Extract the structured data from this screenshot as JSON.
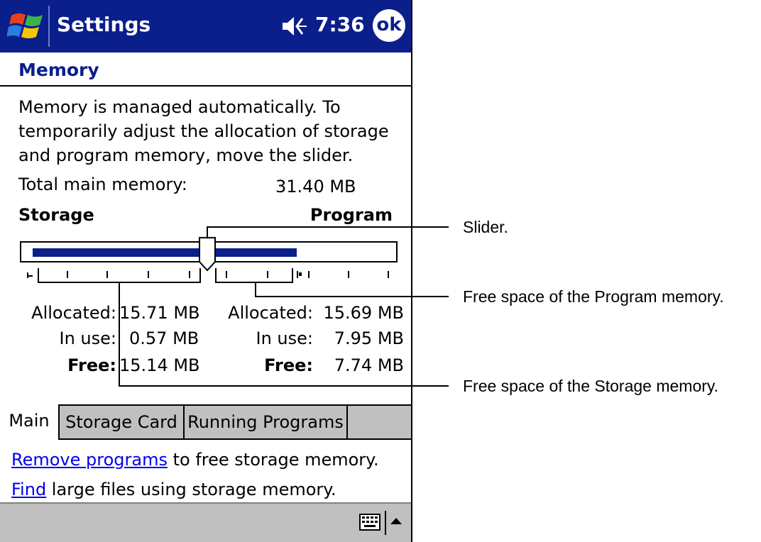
{
  "titlebar": {
    "title": "Settings",
    "time": "7:36",
    "ok_label": "ok"
  },
  "page": {
    "heading": "Memory",
    "description": "Memory is managed automatically. To temporarily adjust the allocation of storage and program memory, move the slider.",
    "total_label": "Total main memory:",
    "total_value": "31.40 MB",
    "storage_label": "Storage",
    "program_label": "Program"
  },
  "slider": {
    "storage_fraction": 0.5,
    "program_in_use_fraction": 0.75
  },
  "storage": {
    "allocated_label": "Allocated:",
    "allocated_value": "15.71 MB",
    "in_use_label": "In use:",
    "in_use_value": "0.57 MB",
    "free_label": "Free:",
    "free_value": "15.14 MB"
  },
  "program": {
    "allocated_label": "Allocated:",
    "allocated_value": "15.69 MB",
    "in_use_label": "In use:",
    "in_use_value": "7.95 MB",
    "free_label": "Free:",
    "free_value": "7.74 MB"
  },
  "tabs": [
    {
      "label": "Main",
      "active": true
    },
    {
      "label": "Storage Card",
      "active": false
    },
    {
      "label": "Running Programs",
      "active": false
    }
  ],
  "links": {
    "remove_link": "Remove programs",
    "remove_rest": " to free storage memory.",
    "find_link": "Find",
    "find_rest": " large files using storage memory."
  },
  "callouts": {
    "slider": "Slider.",
    "program_free": "Free space of the Program memory.",
    "storage_free": "Free space of the Storage memory."
  },
  "colors": {
    "titlebar": "#0a1e8c",
    "link": "#0000ee",
    "tabbar": "#c0c0c0"
  }
}
